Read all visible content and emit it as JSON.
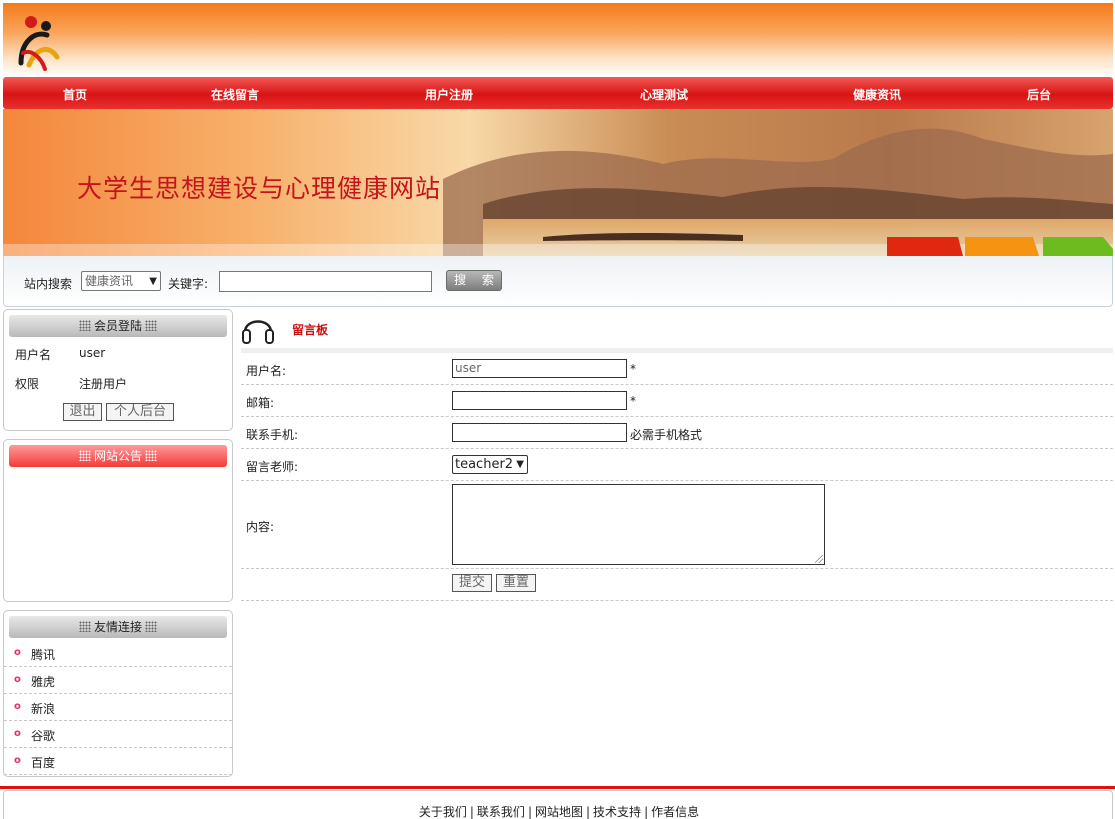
{
  "site": {
    "banner_title": "大学生思想建设与心理健康网站"
  },
  "nav": {
    "items": [
      "首页",
      "在线留言",
      "用户注册",
      "心理测试",
      "健康资讯",
      "后台"
    ]
  },
  "search": {
    "label": "站内搜索",
    "category": "健康资讯",
    "keyword_label": "关键字:",
    "keyword_value": "",
    "button": "搜 索"
  },
  "login_panel": {
    "title": "会员登陆",
    "username_label": "用户名",
    "username_value": "user",
    "role_label": "权限",
    "role_value": "注册用户",
    "logout_button": "退出",
    "personal_button": "个人后台"
  },
  "notice_panel": {
    "title": "网站公告"
  },
  "links_panel": {
    "title": "友情连接",
    "items": [
      "腾讯",
      "雅虎",
      "新浪",
      "谷歌",
      "百度"
    ]
  },
  "board": {
    "title": "留言板",
    "fields": {
      "username_label": "用户名:",
      "username_value": "user",
      "email_label": "邮箱:",
      "email_value": "",
      "phone_label": "联系手机:",
      "phone_value": "",
      "phone_note": "必需手机格式",
      "teacher_label": "留言老师:",
      "teacher_value": "teacher2",
      "content_label": "内容:",
      "required_mark": "*"
    },
    "submit_button": "提交",
    "reset_button": "重置"
  },
  "footer": {
    "links": [
      "关于我们",
      "联系我们",
      "网站地图",
      "技术支持",
      "作者信息"
    ],
    "separator": "|"
  },
  "colors": {
    "nav_red": "#d81414",
    "header_orange": "#f57a1c",
    "title_red": "#c4141e"
  }
}
